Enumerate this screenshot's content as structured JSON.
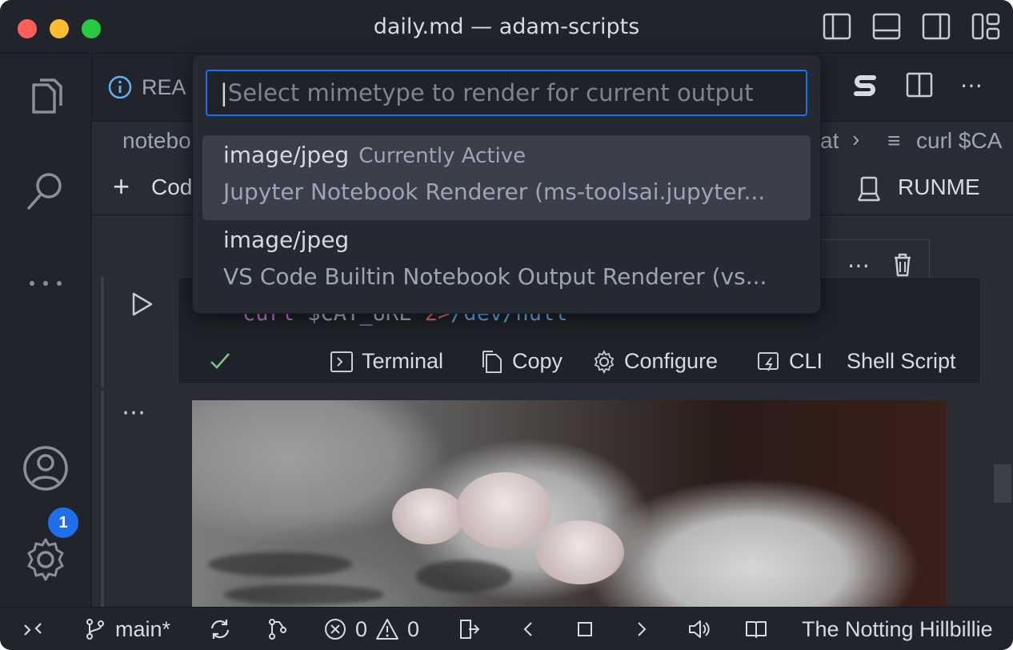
{
  "window": {
    "title": "daily.md — adam-scripts"
  },
  "tab": {
    "label": "REA"
  },
  "breadcrumbs": {
    "left": "notebo",
    "right_fragment": "at",
    "right_label": "curl $CA"
  },
  "toolbar": {
    "add_code": "Cod",
    "runme": "RUNME"
  },
  "quickpick": {
    "placeholder": "Select mimetype to render for current output",
    "items": [
      {
        "mime": "image/jpeg",
        "note": "Currently Active",
        "description": "Jupyter Notebook Renderer (ms-toolsai.jupyter..."
      },
      {
        "mime": "image/jpeg",
        "note": "",
        "description": "VS Code Builtin Notebook Output Renderer (vs..."
      }
    ]
  },
  "cell": {
    "code_kw": "curl",
    "code_var": " $CAT_URL ",
    "code_redirect": "2>",
    "code_path": "/dev/null",
    "actions": {
      "terminal": "Terminal",
      "copy": "Copy",
      "configure": "Configure",
      "cli": "CLI",
      "shell": "Shell Script"
    }
  },
  "activity": {
    "settings_badge": "1"
  },
  "statusbar": {
    "branch": "main*",
    "errors": "0",
    "warnings": "0",
    "now_playing": "The Notting Hillbillie"
  },
  "colors": {
    "accent": "#1f6feb",
    "success": "#73c991"
  }
}
